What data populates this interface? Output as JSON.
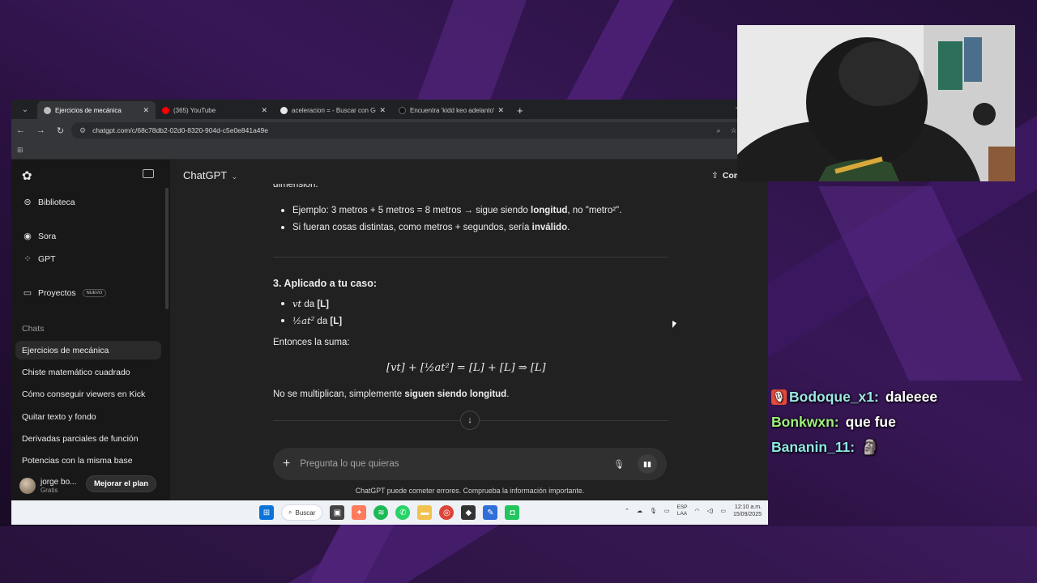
{
  "browser": {
    "tabs": [
      {
        "title": "Ejercicios de mecánica",
        "active": true,
        "favicon_color": "#bdbdbd"
      },
      {
        "title": "(365) YouTube",
        "active": false,
        "favicon_color": "#ff0000"
      },
      {
        "title": "aceleracion = - Buscar con Goo",
        "active": false,
        "favicon_color": "#e8e8e8"
      },
      {
        "title": "Encuentra 'kidd keo adelanto' e",
        "active": false,
        "favicon_color": "#111111"
      }
    ],
    "url": "chatgpt.com/c/68c78db2-02d0-8320-904d-c5e0e841a49e"
  },
  "sidebar": {
    "items": [
      {
        "label": "Biblioteca",
        "icon": "library-icon"
      },
      {
        "label": "Sora",
        "icon": "sora-icon"
      },
      {
        "label": "GPT",
        "icon": "grid-icon"
      },
      {
        "label": "Proyectos",
        "icon": "folder-icon",
        "badge": "NUEVO"
      }
    ],
    "chats_heading": "Chats",
    "chats": [
      "Ejercicios de mecánica",
      "Chiste matemático cuadrado",
      "Cómo conseguir viewers en Kick",
      "Quitar texto y fondo",
      "Derivadas parciales de función",
      "Potencias con la misma base"
    ],
    "user_name": "jorge bo...",
    "user_plan": "Gratis",
    "upgrade_label": "Mejorar el plan"
  },
  "header": {
    "model": "ChatGPT",
    "share_label": "Compartir"
  },
  "conversation": {
    "cut_line": "dimensión.",
    "bullets_top": [
      {
        "pre": "Ejemplo: 3 metros + 5 metros = 8 metros → sigue siendo ",
        "bold": "longitud",
        "post": ", no \"metro²\"."
      },
      {
        "pre": "Si fueran cosas distintas, como metros + segundos, sería ",
        "bold": "inválido",
        "post": "."
      }
    ],
    "section_title": "3. Aplicado a tu caso:",
    "case_bullets": [
      {
        "math": "vt",
        "text": " da ",
        "bold": "[L]"
      },
      {
        "math": "½at²",
        "text": " da ",
        "bold": "[L]"
      }
    ],
    "sum_intro": "Entonces la suma:",
    "equation": "[vt] + [½at²] = [L] + [L]   ⇒   [L]",
    "conclusion_pre": "No se multiplican, simplemente ",
    "conclusion_bold": "siguen siendo longitud",
    "conclusion_post": "."
  },
  "composer": {
    "placeholder": "Pregunta lo que quieras",
    "disclaimer": "ChatGPT puede cometer errores. Comprueba la información importante."
  },
  "taskbar": {
    "search_label": "Buscar",
    "lang_line1": "ESP",
    "lang_line2": "LAA",
    "time": "12:10 a.m.",
    "date": "15/09/2025"
  },
  "stream_chat": [
    {
      "user": "Bodoque_x1:",
      "message": "daleeee",
      "color": "#9ee6e6",
      "badge": "mic-badge-icon"
    },
    {
      "user": "Bonkwxn:",
      "message": "que fue",
      "color": "#9ef07a"
    },
    {
      "user": "Bananin_11:",
      "message": "🗿",
      "color": "#8ee6e6"
    }
  ]
}
